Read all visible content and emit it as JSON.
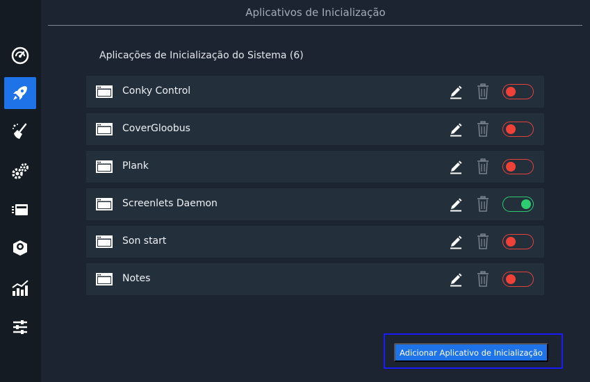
{
  "window": {
    "title": "Aplicativos de Inicialização"
  },
  "sidebar": {
    "items": [
      {
        "id": "dashboard",
        "icon": "speedometer-icon",
        "active": false
      },
      {
        "id": "startup",
        "icon": "rocket-icon",
        "active": true
      },
      {
        "id": "cleaner",
        "icon": "broom-icon",
        "active": false
      },
      {
        "id": "services",
        "icon": "gears-icon",
        "active": false
      },
      {
        "id": "processes",
        "icon": "stack-icon",
        "active": false
      },
      {
        "id": "uninstaller",
        "icon": "package-icon",
        "active": false
      },
      {
        "id": "resources",
        "icon": "bar-chart-icon",
        "active": false
      },
      {
        "id": "settings",
        "icon": "sliders-icon",
        "active": false
      }
    ]
  },
  "main": {
    "section_header": "Aplicações de Inicialização do Sistema (6)",
    "apps": [
      {
        "name": "Conky Control",
        "enabled": false
      },
      {
        "name": "CoverGloobus",
        "enabled": false
      },
      {
        "name": "Plank",
        "enabled": false
      },
      {
        "name": "Screenlets Daemon",
        "enabled": true
      },
      {
        "name": "Son start",
        "enabled": false
      },
      {
        "name": "Notes",
        "enabled": false
      }
    ],
    "add_button_label": "Adicionar Aplicativo de Inicialização"
  },
  "colors": {
    "background": "#1b2430",
    "sidebar": "#141b23",
    "row": "#242f3c",
    "accent": "#1e73e8",
    "toggle_off": "#ef4137",
    "toggle_on": "#2ecc71"
  }
}
